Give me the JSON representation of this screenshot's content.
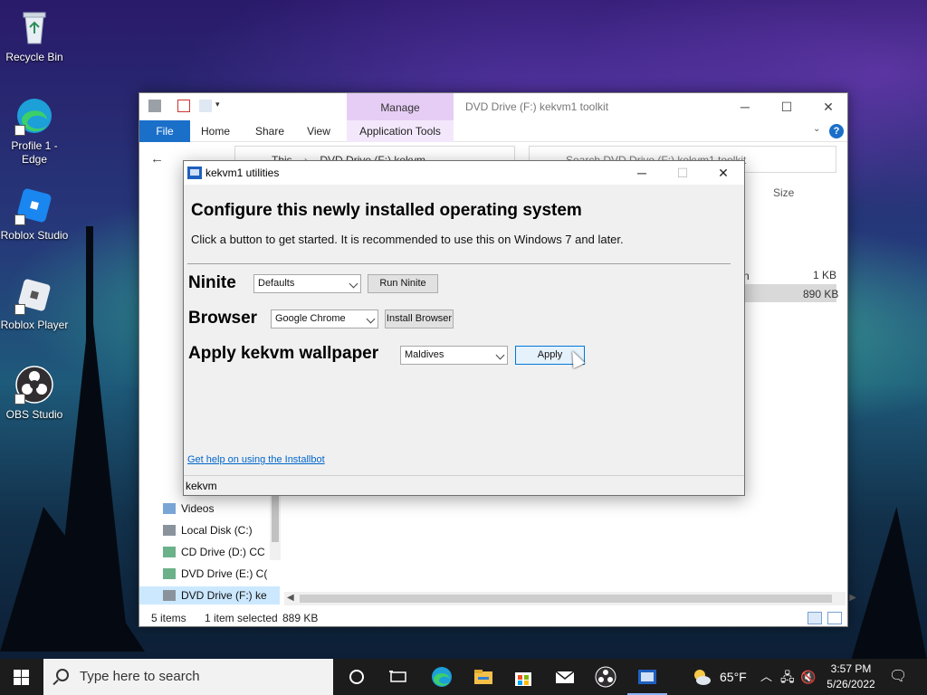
{
  "desktop": {
    "icons": [
      {
        "label": "Recycle Bin",
        "icon": "recycle-bin-icon"
      },
      {
        "label": "Profile 1 - Edge",
        "icon": "edge-icon"
      },
      {
        "label": "Roblox Studio",
        "icon": "roblox-studio-icon"
      },
      {
        "label": "Roblox Player",
        "icon": "roblox-player-icon"
      },
      {
        "label": "OBS Studio",
        "icon": "obs-icon"
      }
    ]
  },
  "explorer": {
    "title": "DVD Drive (F:) kekvm1 toolkit",
    "context_tab_group": "Manage",
    "tabs": {
      "file": "File",
      "home": "Home",
      "share": "Share",
      "view": "View",
      "app_tools": "Application Tools"
    },
    "address_this": "This",
    "address_drive": "DVD Drive (F:) kekvm",
    "search_placeholder": "Search DVD Drive (F:) kekvm1 toolkit",
    "column_size": "Size",
    "column_partial": "n",
    "file_sizes": [
      "1 KB",
      "890 KB"
    ],
    "nav_items": [
      {
        "label": "Videos"
      },
      {
        "label": "Local Disk (C:)"
      },
      {
        "label": "CD Drive (D:) CC"
      },
      {
        "label": "DVD Drive (E:) C("
      },
      {
        "label": "DVD Drive (F:) ke"
      }
    ],
    "status": {
      "items": "5 items",
      "selected": "1 item selected",
      "size": "889 KB"
    },
    "help_glyph": "?"
  },
  "dialog": {
    "title": "kekvm1 utilities",
    "heading": "Configure this newly installed operating system",
    "subheading": "Click a button to get started. It is recommended to use this on Windows 7 and later.",
    "rows": [
      {
        "label": "Ninite",
        "select_value": "Defaults",
        "button": "Run Ninite"
      },
      {
        "label": "Browser",
        "select_value": "Google Chrome",
        "button": "Install Browser"
      },
      {
        "label": "Apply kekvm wallpaper",
        "select_value": "Maldives",
        "button": "Apply"
      }
    ],
    "help_link": "Get help on using the Installbot",
    "status": "kekvm"
  },
  "taskbar": {
    "search_placeholder": "Type here to search",
    "weather": "65°F",
    "time": "3:57 PM",
    "date": "5/26/2022"
  }
}
